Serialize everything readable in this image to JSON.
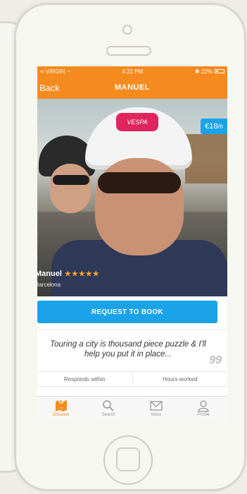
{
  "status_bar": {
    "carrier": "VIRGIN",
    "time": "4:21 PM",
    "battery": "22%"
  },
  "nav": {
    "back_label": "Back",
    "title": "MANUEL"
  },
  "hero": {
    "helmet_brand": "VESPA",
    "price_value": "€18",
    "price_unit": "/h",
    "host_name": "Manuel",
    "rating_stars": "★★★★★",
    "host_city": "Barcelona"
  },
  "actions": {
    "book_label": "REQUEST TO BOOK"
  },
  "quote": {
    "text": "Touring a city is thousand piece puzzle & I'll help you put it in place...",
    "mark": "99"
  },
  "stats": {
    "responds_label": "Responds within",
    "hours_label": "Hours worked"
  },
  "tabbar": {
    "items": [
      {
        "label": "Discover",
        "icon": "map-icon",
        "active": true
      },
      {
        "label": "Search",
        "icon": "search-icon",
        "active": false
      },
      {
        "label": "Inbox",
        "icon": "envelope-icon",
        "active": false
      },
      {
        "label": "Profile",
        "icon": "user-icon",
        "active": false
      }
    ]
  },
  "colors": {
    "brand_orange": "#f58a1e",
    "accent_blue": "#1aa3e8",
    "star_gold": "#f5a623"
  }
}
